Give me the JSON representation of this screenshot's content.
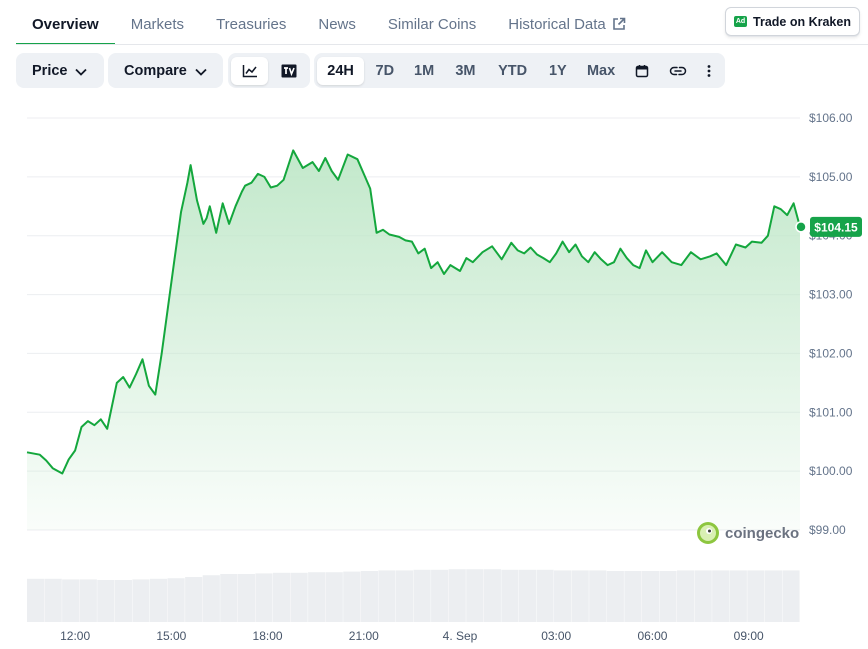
{
  "tabs": [
    {
      "label": "Overview",
      "active": true
    },
    {
      "label": "Markets"
    },
    {
      "label": "Treasuries"
    },
    {
      "label": "News"
    },
    {
      "label": "Similar Coins"
    },
    {
      "label": "Historical Data",
      "icon": "external-link-icon"
    }
  ],
  "ad_button": {
    "badge": "Ad",
    "label": "Trade on Kraken"
  },
  "toolbar": {
    "price_dropdown": "Price",
    "compare_dropdown": "Compare",
    "chart_type_icons": [
      "line-chart-icon",
      "tradingview-icon"
    ],
    "ranges": [
      "24H",
      "7D",
      "1M",
      "3M",
      "YTD",
      "1Y",
      "Max"
    ],
    "active_range": "24H",
    "extra_icons": [
      "calendar-icon",
      "link-icon",
      "more-vertical-icon"
    ]
  },
  "watermark": "coingecko",
  "colors": {
    "accent": "#16a34a",
    "line": "#14a73d",
    "fill_top": "#bfe7c8"
  },
  "chart_data": {
    "type": "area",
    "y_ticks": [
      "$106.00",
      "$105.00",
      "$104.00",
      "$103.00",
      "$102.00",
      "$101.00",
      "$100.00",
      "$99.00"
    ],
    "y_values": [
      106,
      105,
      104,
      103,
      102,
      101,
      100,
      99
    ],
    "ylim": [
      98.5,
      106.2
    ],
    "x_ticks": [
      "12:00",
      "15:00",
      "18:00",
      "21:00",
      "4. Sep",
      "03:00",
      "06:00",
      "09:00"
    ],
    "x_tick_hours": [
      12,
      15,
      18,
      21,
      24,
      27,
      30,
      33
    ],
    "xlim_hours": [
      10.5,
      34.6
    ],
    "current_price_label": "$104.15",
    "current_price": 104.15,
    "series": [
      {
        "x": [
          10.5,
          10.9,
          11.1,
          11.3,
          11.6,
          11.8,
          12.0,
          12.2,
          12.4,
          12.6,
          12.8,
          13.0,
          13.3,
          13.5,
          13.7,
          13.9,
          14.1,
          14.3,
          14.5,
          14.7,
          14.9,
          15.1,
          15.3,
          15.5,
          15.6,
          15.8,
          16.0,
          16.1,
          16.2,
          16.4,
          16.6,
          16.8,
          17.0,
          17.2,
          17.3,
          17.5,
          17.7,
          17.9,
          18.1,
          18.3,
          18.5,
          18.8,
          19.1,
          19.4,
          19.6,
          19.8,
          20.0,
          20.2,
          20.5,
          20.8,
          21.0,
          21.2,
          21.4,
          21.6,
          21.8,
          22.1,
          22.3,
          22.5,
          22.7,
          22.9,
          23.1,
          23.3,
          23.5,
          23.7,
          24.0,
          24.2,
          24.4,
          24.7,
          25.0,
          25.3,
          25.6,
          25.8,
          26.0,
          26.2,
          26.4,
          26.6,
          26.8,
          27.0,
          27.2,
          27.4,
          27.6,
          27.8,
          28.0,
          28.2,
          28.4,
          28.6,
          28.8,
          29.0,
          29.2,
          29.4,
          29.6,
          29.8,
          30.0,
          30.3,
          30.6,
          30.9,
          31.2,
          31.5,
          31.8,
          32.0,
          32.3,
          32.6,
          32.9,
          33.1,
          33.4,
          33.6,
          33.8,
          34.0,
          34.2,
          34.4,
          34.6
        ],
        "y": [
          100.32,
          100.28,
          100.18,
          100.05,
          99.96,
          100.2,
          100.35,
          100.75,
          100.85,
          100.78,
          100.88,
          100.72,
          101.5,
          101.6,
          101.42,
          101.65,
          101.9,
          101.45,
          101.3,
          102.0,
          102.8,
          103.6,
          104.4,
          104.9,
          105.2,
          104.6,
          104.2,
          104.3,
          104.5,
          104.05,
          104.55,
          104.2,
          104.5,
          104.75,
          104.85,
          104.9,
          105.05,
          105.0,
          104.82,
          104.85,
          104.95,
          105.45,
          105.15,
          105.25,
          105.1,
          105.32,
          105.1,
          104.95,
          105.38,
          105.3,
          105.05,
          104.8,
          104.05,
          104.1,
          104.02,
          103.98,
          103.92,
          103.9,
          103.7,
          103.78,
          103.45,
          103.55,
          103.35,
          103.5,
          103.4,
          103.62,
          103.55,
          103.72,
          103.82,
          103.6,
          103.88,
          103.75,
          103.7,
          103.8,
          103.68,
          103.62,
          103.55,
          103.7,
          103.9,
          103.72,
          103.85,
          103.65,
          103.55,
          103.72,
          103.6,
          103.5,
          103.55,
          103.78,
          103.62,
          103.5,
          103.45,
          103.75,
          103.55,
          103.72,
          103.55,
          103.5,
          103.72,
          103.6,
          103.65,
          103.7,
          103.5,
          103.85,
          103.8,
          103.9,
          103.88,
          104.0,
          104.5,
          104.45,
          104.35,
          104.55,
          104.15
        ]
      }
    ],
    "volume_relative": [
      0.72,
      0.72,
      0.71,
      0.71,
      0.7,
      0.7,
      0.71,
      0.72,
      0.73,
      0.75,
      0.78,
      0.8,
      0.8,
      0.81,
      0.82,
      0.82,
      0.83,
      0.83,
      0.84,
      0.85,
      0.86,
      0.86,
      0.87,
      0.87,
      0.88,
      0.88,
      0.88,
      0.87,
      0.87,
      0.87,
      0.86,
      0.86,
      0.86,
      0.85,
      0.85,
      0.85,
      0.85,
      0.86,
      0.86,
      0.86,
      0.86,
      0.86,
      0.86,
      0.86
    ]
  }
}
